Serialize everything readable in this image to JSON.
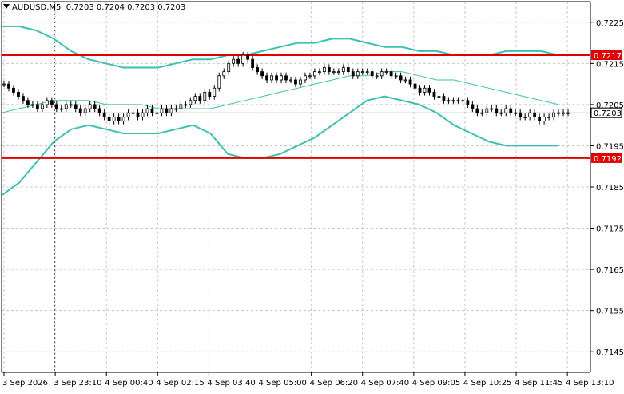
{
  "header": {
    "symbol": "AUDUSD,M5",
    "ohlc": "0.7203 0.7204 0.7203 0.7203"
  },
  "colors": {
    "background": "#ffffff",
    "grid": "#c8c8c8",
    "candles": "#000000",
    "bands": "#3cc0b0",
    "support_resistance": "#e00000",
    "current_price_box": "#ffffff"
  },
  "chart_data": {
    "type": "candlestick",
    "title": "",
    "xlabel": "",
    "ylabel": "",
    "grid": true,
    "ylim": [
      0.714,
      0.723
    ],
    "y_ticks": [
      "0.7225",
      "0.7215",
      "0.7205",
      "0.7195",
      "0.7185",
      "0.7175",
      "0.7165",
      "0.7155",
      "0.7145"
    ],
    "x_ticks": [
      "3 Sep 2026",
      "3 Sep 23:10",
      "4 Sep 00:40",
      "4 Sep 02:15",
      "4 Sep 03:40",
      "4 Sep 05:00",
      "4 Sep 06:20",
      "4 Sep 07:40",
      "4 Sep 09:05",
      "4 Sep 10:25",
      "4 Sep 11:45",
      "4 Sep 13:10"
    ],
    "horizontal_levels": [
      {
        "label": "0.7217",
        "value": 0.7217
      },
      {
        "label": "0.7192",
        "value": 0.7192
      }
    ],
    "current_price": {
      "label": "0.7203",
      "value": 0.7203
    },
    "crosshair_x_tick": "3 Sep 23:10",
    "candle_closes": [
      0.721,
      0.7209,
      0.7208,
      0.7207,
      0.7206,
      0.7205,
      0.7205,
      0.7204,
      0.7205,
      0.7206,
      0.7205,
      0.7204,
      0.7204,
      0.7205,
      0.7205,
      0.7204,
      0.7203,
      0.7204,
      0.7205,
      0.7204,
      0.7203,
      0.7202,
      0.7201,
      0.7202,
      0.7201,
      0.7202,
      0.7203,
      0.7203,
      0.7202,
      0.7203,
      0.7204,
      0.7203,
      0.7203,
      0.7204,
      0.7203,
      0.7204,
      0.7204,
      0.7205,
      0.7205,
      0.7206,
      0.7207,
      0.7206,
      0.7208,
      0.7207,
      0.7209,
      0.7212,
      0.7213,
      0.7215,
      0.7216,
      0.7215,
      0.7217,
      0.7216,
      0.7214,
      0.7213,
      0.7212,
      0.7211,
      0.7212,
      0.7211,
      0.7212,
      0.7211,
      0.7211,
      0.721,
      0.7211,
      0.7212,
      0.7212,
      0.7213,
      0.7213,
      0.7214,
      0.7213,
      0.7213,
      0.7213,
      0.7214,
      0.7213,
      0.7212,
      0.7213,
      0.7213,
      0.7213,
      0.7212,
      0.7212,
      0.7213,
      0.7213,
      0.7212,
      0.7212,
      0.7211,
      0.7211,
      0.721,
      0.7209,
      0.7208,
      0.7209,
      0.7208,
      0.7207,
      0.7207,
      0.7206,
      0.7206,
      0.7206,
      0.7206,
      0.7206,
      0.7205,
      0.7204,
      0.7203,
      0.7203,
      0.7204,
      0.7204,
      0.7203,
      0.7203,
      0.7204,
      0.7203,
      0.7203,
      0.7202,
      0.7202,
      0.7203,
      0.7202,
      0.7201,
      0.7202,
      0.7202,
      0.7203,
      0.7203,
      0.7203,
      0.7203
    ],
    "upper_band": [
      0.7224,
      0.7224,
      0.7223,
      0.7221,
      0.7218,
      0.7216,
      0.7215,
      0.7214,
      0.7214,
      0.7214,
      0.7215,
      0.7216,
      0.7216,
      0.7217,
      0.7217,
      0.7218,
      0.7219,
      0.722,
      0.722,
      0.7221,
      0.7221,
      0.722,
      0.7219,
      0.7219,
      0.7218,
      0.7218,
      0.7217,
      0.7217,
      0.7217,
      0.7218,
      0.7218,
      0.7218,
      0.7217
    ],
    "middle_band": [
      0.7203,
      0.7204,
      0.7205,
      0.7206,
      0.7206,
      0.7206,
      0.7205,
      0.7205,
      0.7205,
      0.7204,
      0.7204,
      0.7204,
      0.7204,
      0.7205,
      0.7206,
      0.7207,
      0.7208,
      0.7209,
      0.721,
      0.7211,
      0.7212,
      0.7212,
      0.7213,
      0.7213,
      0.7212,
      0.7211,
      0.7211,
      0.721,
      0.7209,
      0.7208,
      0.7207,
      0.7206,
      0.7205
    ],
    "lower_band": [
      0.7183,
      0.7186,
      0.7191,
      0.7196,
      0.7199,
      0.72,
      0.7199,
      0.7198,
      0.7198,
      0.7198,
      0.7199,
      0.72,
      0.7198,
      0.7193,
      0.7192,
      0.7192,
      0.7193,
      0.7195,
      0.7197,
      0.72,
      0.7203,
      0.7206,
      0.7207,
      0.7206,
      0.7205,
      0.7203,
      0.72,
      0.7198,
      0.7196,
      0.7195,
      0.7195,
      0.7195,
      0.7195
    ]
  }
}
